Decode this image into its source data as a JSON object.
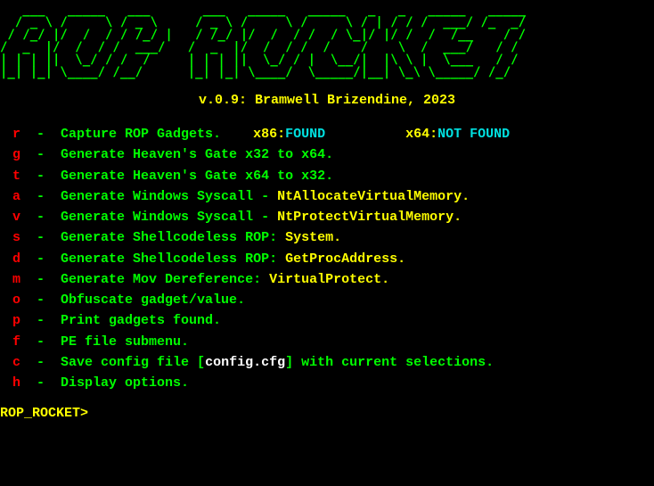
{
  "ascii_art": "   ___   _____   ___       ___   _____   _____   _   _   _____   _____\n  / _ \\ /     \\ / _ \\     / _ \\ /     \\ /     \\ / | / / /  ___/ /_  _/\n / /_/ |/  /  / / /_/ |   / /_/ |/  /  / /  / \\_|/ |/ /  /  /__    / /\n/  _  |/  /  / /  ___/   /  _  |/  /  / /  /    /    \\  /  ___/   / /\n| | | ||  \\_/ / /  /     | | | ||  \\_/ / |  \\__/|  |\\ \\ |  \\___   / /\n|_| |_| \\____/ /__/      |_| |_| \\____/  \\_____/|__| \\_\\ \\_____/ /_/",
  "version": "v.0.9:  Bramwell Brizendine, 2023",
  "x86_label": "x86:",
  "x86_status": "FOUND",
  "x64_label": "x64:",
  "x64_status": "NOT FOUND",
  "menu": {
    "r_key": "r",
    "r_text": "Capture ROP Gadgets.",
    "g_key": "g",
    "g_text": "Generate Heaven's Gate x32 to x64.",
    "t_key": "t",
    "t_text": "Generate Heaven's Gate x64 to x32.",
    "a_key": "a",
    "a_text1": "Generate Windows Syscall - ",
    "a_text2": "NtAllocateVirtualMemory.",
    "v_key": "v",
    "v_text1": "Generate Windows Syscall - ",
    "v_text2": "NtProtectVirtualMemory.",
    "s_key": "s",
    "s_text1": "Generate Shellcodeless ROP: ",
    "s_text2": "System.",
    "d_key": "d",
    "d_text1": "Generate Shellcodeless ROP: ",
    "d_text2": "GetProcAddress.",
    "m_key": "m",
    "m_text1": "Generate Mov Dereference: ",
    "m_text2": "VirtualProtect.",
    "o_key": "o",
    "o_text": "Obfuscate gadget/value.",
    "p_key": "p",
    "p_text": "Print gadgets found.",
    "f_key": "f",
    "f_text": "PE file submenu.",
    "c_key": "c",
    "c_text1": "Save config file [",
    "c_file": "config.cfg",
    "c_text2": "] with current selections.",
    "h_key": "h",
    "h_text": "Display options."
  },
  "prompt": "ROP_ROCKET>"
}
